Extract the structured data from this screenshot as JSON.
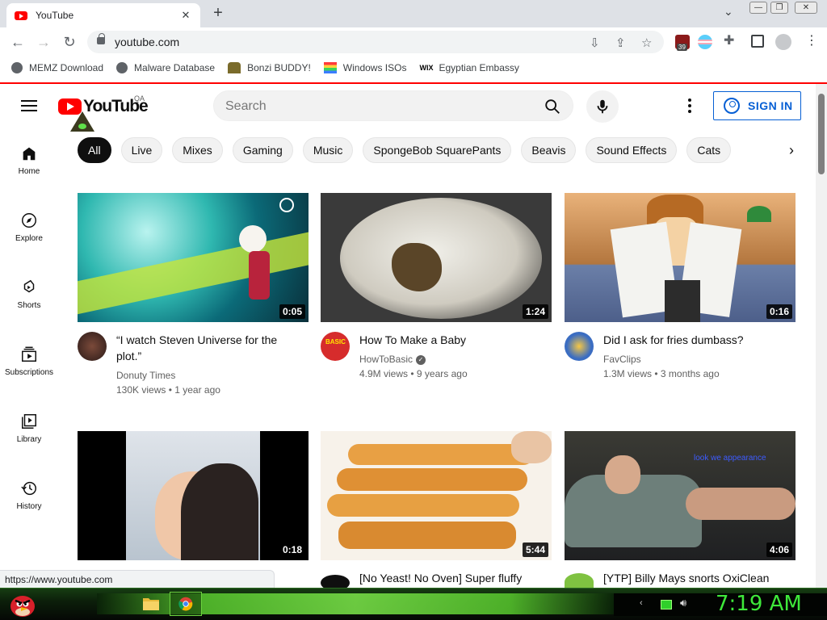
{
  "browser": {
    "tab_title": "YouTube",
    "url": "youtube.com",
    "extension_badge": "39",
    "status_url": "https://www.youtube.com",
    "page_load_fraction": 1.0
  },
  "bookmarks": [
    {
      "label": "MEMZ Download",
      "icon": "globe-icon"
    },
    {
      "label": "Malware Database",
      "icon": "globe-icon"
    },
    {
      "label": "Bonzi BUDDY!",
      "icon": "gorilla-icon"
    },
    {
      "label": "Windows ISOs",
      "icon": "windows-flag-icon"
    },
    {
      "label": "Egyptian Embassy",
      "icon": "wix-icon"
    }
  ],
  "youtube": {
    "logo_text": "YouTube",
    "region": "QA",
    "search_placeholder": "Search",
    "signin_label": "SIGN IN",
    "sidebar": [
      {
        "label": "Home",
        "icon": "home-icon"
      },
      {
        "label": "Explore",
        "icon": "compass-icon"
      },
      {
        "label": "Shorts",
        "icon": "shorts-icon"
      },
      {
        "label": "Subscriptions",
        "icon": "subscriptions-icon"
      },
      {
        "label": "Library",
        "icon": "library-icon"
      },
      {
        "label": "History",
        "icon": "history-icon"
      }
    ],
    "chips": [
      "All",
      "Live",
      "Mixes",
      "Gaming",
      "Music",
      "SpongeBob SquarePants",
      "Beavis",
      "Sound Effects",
      "Cats"
    ],
    "videos": [
      {
        "title": "“I watch Steven Universe for the plot.”",
        "channel": "Donuty Times",
        "views": "130K views",
        "age": "1 year ago",
        "duration": "0:05",
        "verified": false
      },
      {
        "title": "How To Make a Baby",
        "channel": "HowToBasic",
        "views": "4.9M views",
        "age": "9 years ago",
        "duration": "1:24",
        "verified": true
      },
      {
        "title": "Did I ask for fries dumbass?",
        "channel": "FavClips",
        "views": "1.3M views",
        "age": "3 months ago",
        "duration": "0:16",
        "verified": false
      },
      {
        "title": "",
        "channel": "",
        "views": "",
        "age": "",
        "duration": "0:18",
        "verified": false
      },
      {
        "title": "[No Yeast! No Oven] Super fluffy",
        "channel": "",
        "views": "",
        "age": "",
        "duration": "5:44",
        "verified": false
      },
      {
        "title": "[YTP] Billy Mays snorts OxiClean",
        "channel": "",
        "views": "",
        "age": "",
        "duration": "4:06",
        "verified": false
      }
    ],
    "thumbnail_caption_6": "look we appearance"
  },
  "taskbar": {
    "clock": "7:19 AM"
  },
  "colors": {
    "brand_red": "#ff0000",
    "link_blue": "#065fd4",
    "clock_green": "#3ee83a"
  }
}
